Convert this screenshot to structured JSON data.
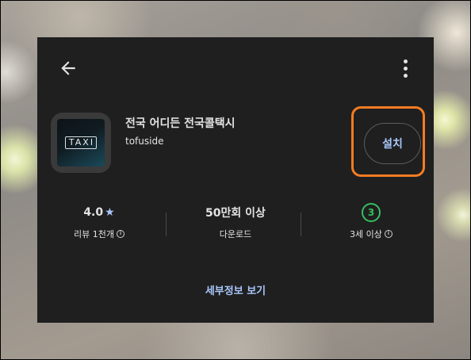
{
  "app": {
    "title": "전국 어디든 전국콜택시",
    "developer": "tofuside",
    "icon_text": "TAXI"
  },
  "actions": {
    "install_label": "설치",
    "details_label": "세부정보 보기"
  },
  "stats": {
    "rating_value": "4.0",
    "rating_label": "리뷰 1천개",
    "downloads_value": "50만회 이상",
    "downloads_label": "다운로드",
    "age_value": "3",
    "age_label": "3세 이상"
  },
  "colors": {
    "accent": "#a8c7fa",
    "highlight": "#f57c22",
    "age_badge": "#37be5f",
    "card_bg": "#1f1f1f"
  },
  "icons": [
    "arrow-back-icon",
    "more-vert-icon",
    "star-icon",
    "info-icon"
  ]
}
